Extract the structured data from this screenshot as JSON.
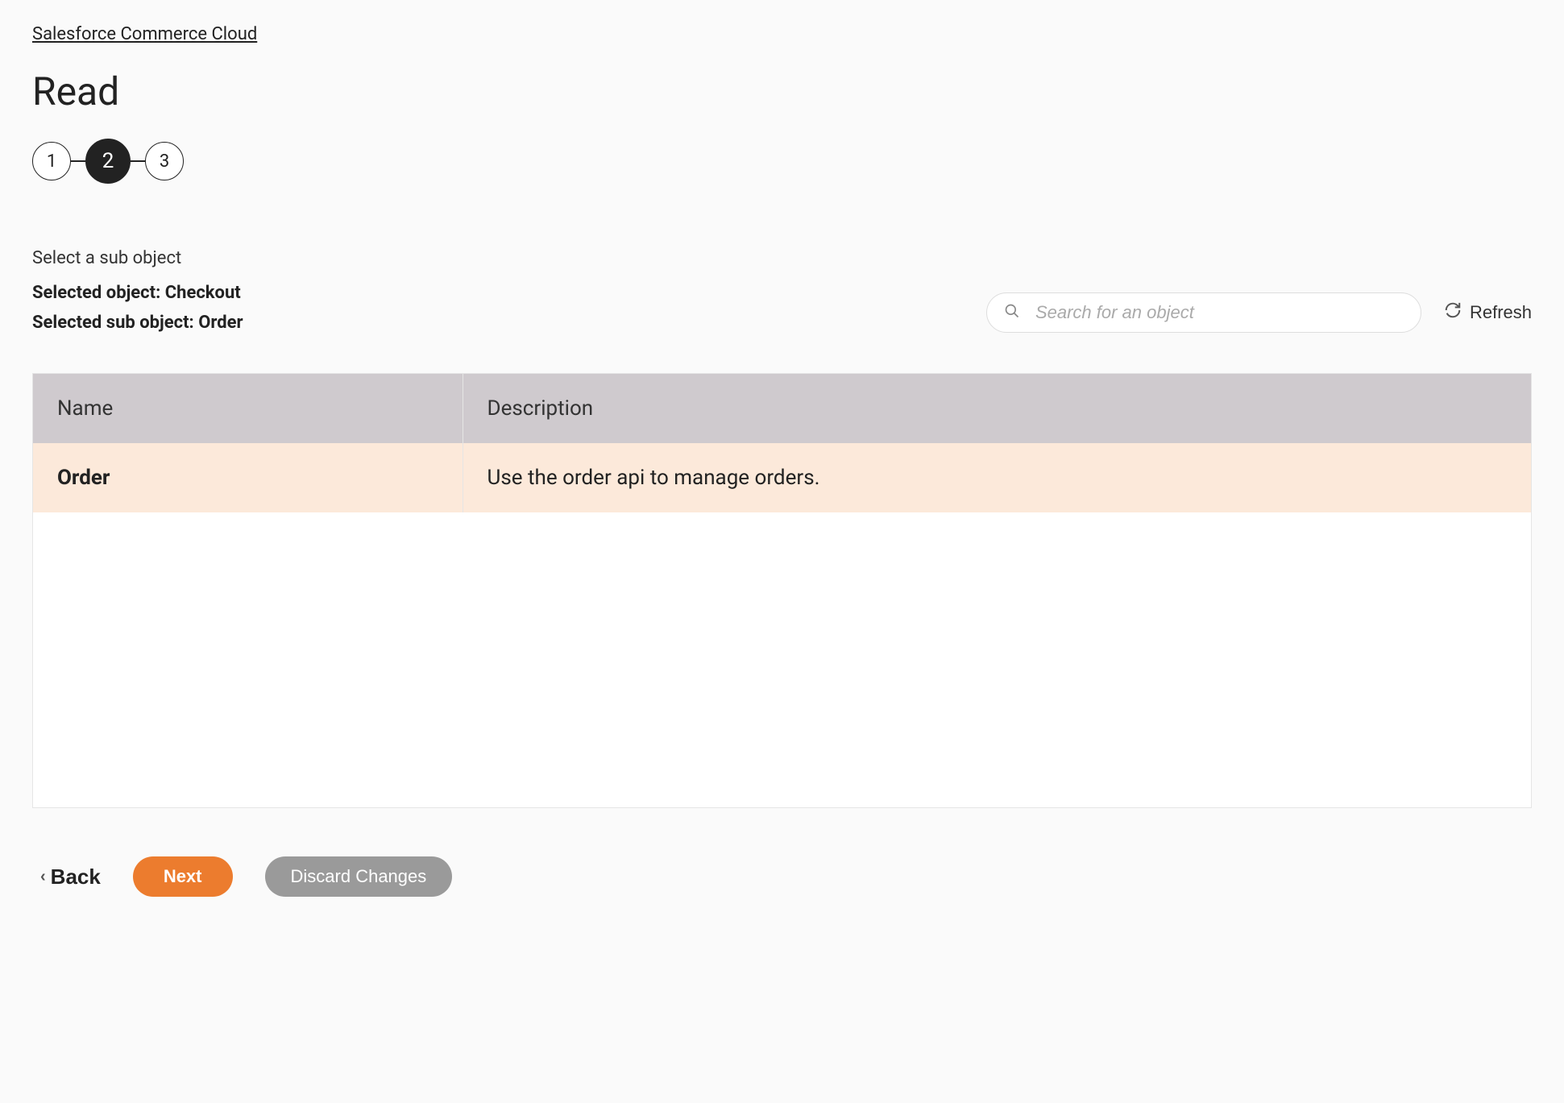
{
  "breadcrumb": "Salesforce Commerce Cloud",
  "page_title": "Read",
  "stepper": {
    "steps": [
      "1",
      "2",
      "3"
    ],
    "active_index": 1
  },
  "intro_text": "Select a sub object",
  "selected_object_label": "Selected object: Checkout",
  "selected_sub_object_label": "Selected sub object: Order",
  "search": {
    "placeholder": "Search for an object"
  },
  "refresh_label": "Refresh",
  "table": {
    "columns": {
      "name": "Name",
      "description": "Description"
    },
    "rows": [
      {
        "name": "Order",
        "description": "Use the order api to manage orders.",
        "selected": true
      }
    ]
  },
  "footer": {
    "back_label": "Back",
    "next_label": "Next",
    "discard_label": "Discard Changes"
  }
}
